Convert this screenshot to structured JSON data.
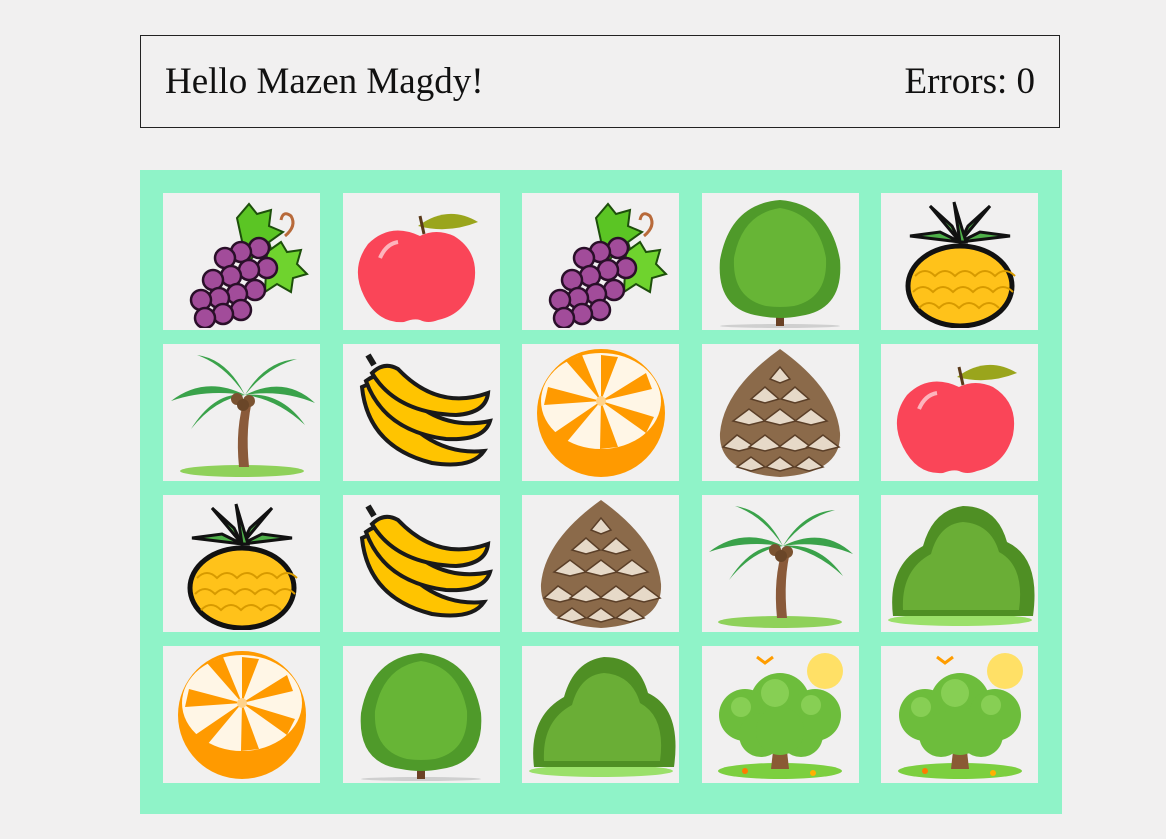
{
  "header": {
    "greeting": "Hello Mazen Magdy!",
    "errors": "Errors: 0"
  },
  "board": {
    "columns": 5,
    "rows": 4,
    "background_color": "#8ff3c8",
    "cards": [
      {
        "icon": "grapes-icon"
      },
      {
        "icon": "apple-icon"
      },
      {
        "icon": "grapes-icon"
      },
      {
        "icon": "round-tree-icon"
      },
      {
        "icon": "pineapple-icon"
      },
      {
        "icon": "palm-tree-icon"
      },
      {
        "icon": "banana-icon"
      },
      {
        "icon": "orange-icon"
      },
      {
        "icon": "pinecone-icon"
      },
      {
        "icon": "apple-icon"
      },
      {
        "icon": "pineapple-icon"
      },
      {
        "icon": "banana-icon"
      },
      {
        "icon": "pinecone-icon"
      },
      {
        "icon": "palm-tree-icon"
      },
      {
        "icon": "bush-icon"
      },
      {
        "icon": "orange-icon"
      },
      {
        "icon": "round-tree-icon"
      },
      {
        "icon": "bush-icon"
      },
      {
        "icon": "cartoon-tree-icon"
      },
      {
        "icon": "cartoon-tree-icon"
      }
    ]
  }
}
